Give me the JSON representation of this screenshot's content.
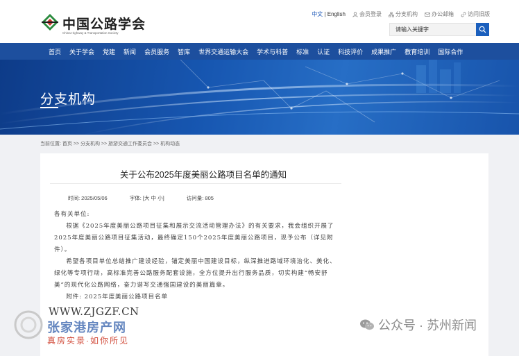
{
  "header": {
    "logo_text": "中国公路学会",
    "logo_subtext": "China Highway & Transportation Society",
    "lang_current": "中文",
    "lang_sep": " | ",
    "lang_other": "English",
    "links": [
      {
        "label": "会员登录",
        "icon": "user-icon"
      },
      {
        "label": "分支机构",
        "icon": "org-icon"
      },
      {
        "label": "办公邮箱",
        "icon": "mail-icon"
      },
      {
        "label": "访问旧版",
        "icon": "link-icon"
      }
    ],
    "search_placeholder": "请输入关键字"
  },
  "nav": {
    "items": [
      "首页",
      "关于学会",
      "党建",
      "新闻",
      "会员服务",
      "智库",
      "世界交通运输大会",
      "学术与科普",
      "标准",
      "认证",
      "科技评价",
      "成果推广",
      "教育培训",
      "国际合作"
    ]
  },
  "banner": {
    "title": "分支机构"
  },
  "breadcrumb": "当前位置: 首页 >> 分支机构 >> 旅游交通工作委员会 >> 机构动态",
  "article": {
    "title": "关于公布2025年度美丽公路项目名单的通知",
    "time": "时间: 2025/05/06",
    "font": "字体: [大 中 小]",
    "views": "访问量: 805",
    "greeting": "各有关单位:",
    "para1": "根据《2025年度美丽公路项目征集和展示交流活动管理办法》的有关要求，我会组织开展了2025年度美丽公路项目征集活动，最终确定150个2025年度美丽公路项目，现予公布（详见附件）。",
    "para2": "希望各项目单位总结推广建设经验，锚定美丽中国建设目标，纵深推进路域环境治化、美化、绿化等专项行动，高标准完善公路服务配套设施，全方位提升出行服务品质，切实构建“畅安舒美”的现代化公路网络，奋力谱写交通强国建设的美丽篇章。",
    "attachment": "附件: 2025年度美丽公路项目名单"
  },
  "watermark": {
    "url": "WWW.ZJGZF.CN",
    "site": "张家港房产网",
    "slogan": "真房实景·如你所见",
    "account": "公众号 · 苏州新闻"
  },
  "colors": {
    "nav_bg": "#1d4f9e",
    "accent": "#1a5fbd"
  }
}
